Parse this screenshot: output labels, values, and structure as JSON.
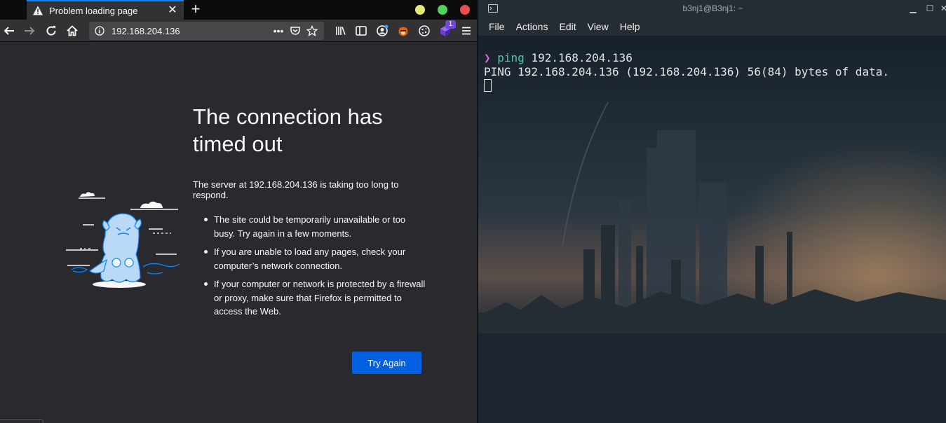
{
  "browser": {
    "tab": {
      "title": "Problem loading page",
      "close_label": "✕",
      "icon": "warning-icon"
    },
    "new_tab_label": "+",
    "url": "192.168.204.136",
    "page_actions_label": "•••",
    "extension_badge": "1",
    "error": {
      "title": "The connection has timed out",
      "description": "The server at 192.168.204.136 is taking too long to respond.",
      "items": [
        "The site could be temporarily unavailable or too busy. Try again in a few moments.",
        "If you are unable to load any pages, check your computer’s network connection.",
        "If your computer or network is protected by a firewall or proxy, make sure that Firefox is permitted to access the Web."
      ],
      "button_label": "Try Again"
    },
    "colors": {
      "accent": "#0060df",
      "tab_highlight": "#0a84ff",
      "background": "#2a2a2e"
    }
  },
  "terminal": {
    "title": "b3nj1@B3nj1: ~",
    "window_controls": {
      "minimize": "▁",
      "maximize": "☐",
      "close": "✕"
    },
    "menu": [
      "File",
      "Actions",
      "Edit",
      "View",
      "Help"
    ],
    "prompt_symbol": "❯",
    "command_name": "ping",
    "command_args": " 192.168.204.136",
    "output": "PING 192.168.204.136 (192.168.204.136) 56(84) bytes of data.",
    "colors": {
      "prompt": "#d66ad0",
      "command": "#4fc4b8",
      "text": "#e6e6e6"
    }
  }
}
